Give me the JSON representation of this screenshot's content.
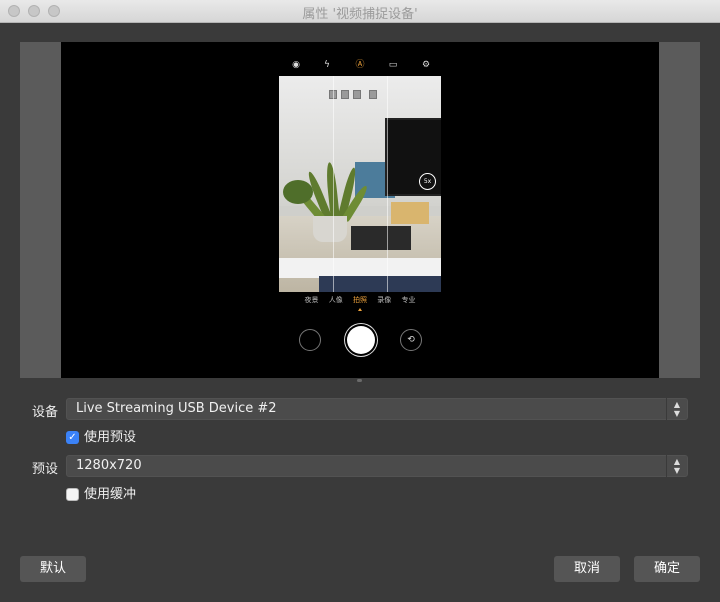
{
  "window": {
    "title": "属性 '视频捕捉设备'"
  },
  "camera": {
    "top_icons": [
      {
        "name": "eye-icon",
        "glyph": "◉"
      },
      {
        "name": "flash-off-icon",
        "glyph": "ϟ"
      },
      {
        "name": "ai-icon",
        "glyph": "A"
      },
      {
        "name": "aspect-ratio-icon",
        "glyph": "▭"
      },
      {
        "name": "settings-icon",
        "glyph": "✲"
      }
    ],
    "zoom_label": "5x",
    "modes": [
      "夜景",
      "人像",
      "拍照",
      "录像",
      "专业"
    ],
    "active_mode": "拍照",
    "accent_color": "#f0a43c"
  },
  "form": {
    "device_label": "设备",
    "device_value": "Live Streaming USB Device #2",
    "use_preset_label": "使用预设",
    "use_preset_checked": true,
    "preset_label": "预设",
    "preset_value": "1280x720",
    "use_buffer_label": "使用缓冲",
    "use_buffer_checked": false
  },
  "buttons": {
    "defaults": "默认",
    "cancel": "取消",
    "ok": "确定"
  }
}
